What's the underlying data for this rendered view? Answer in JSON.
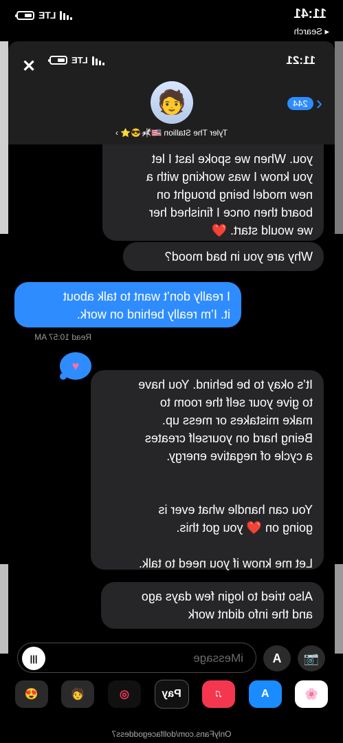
{
  "outer_status": {
    "time": "11:41",
    "back": "◂ Search",
    "network": "LTE"
  },
  "inner_status": {
    "time": "11:21",
    "network": "LTE",
    "close": "✕"
  },
  "header": {
    "unread_count": "244",
    "contact_name": "Tyler The Stallion 🇺🇸🎠😎⭐ ›",
    "avatar_emoji": "🧑"
  },
  "messages": [
    {
      "from": "them",
      "text": "you. When we spoke last I let\nyou know I was working with a\nnew model being brought on\nboard then once I finished her\nwe would start. ❤️"
    },
    {
      "from": "them",
      "text": "Why are you in bad mood?"
    },
    {
      "from": "me",
      "text": "I really don’t want to talk about\nit. I’m really behind on work."
    },
    {
      "from": "them",
      "text": "It’s okay to be behind. You have\nto give your self the room to\nmake mistakes or mess up.\nBeing hard on yourself creates\na cycle of negative energy.\n\n\nYou can handle what ever is\ngoing on ❤️ you got this.\n\nLet me know if you need to talk."
    },
    {
      "from": "them",
      "text": "Also tried to login few days ago\nand the info didnt work"
    }
  ],
  "read_receipt": "Read 10:57 AM",
  "tapback": "♥",
  "composer": {
    "placeholder": "iMessage",
    "camera_icon": "📷",
    "apps_icon": "A",
    "audio_icon": "|||"
  },
  "tray": [
    "🌸",
    "A",
    "♫",
    "Pay",
    "◎",
    "🧑",
    "😍"
  ],
  "watermark": "OnlyFans.com/dollfacegoddess7"
}
